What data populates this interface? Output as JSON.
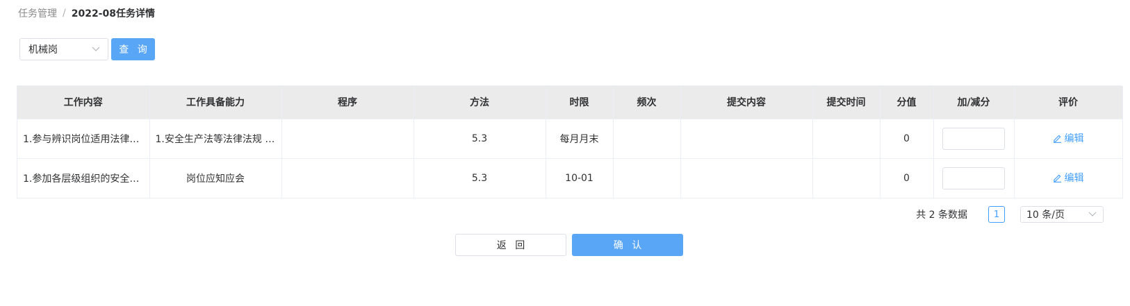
{
  "breadcrumb": {
    "parent": "任务管理",
    "separator": "/",
    "current": "2022-08任务详情"
  },
  "filter": {
    "selected_post": "机械岗",
    "query_label": "查 询"
  },
  "table": {
    "columns": [
      "工作内容",
      "工作具备能力",
      "程序",
      "方法",
      "时限",
      "频次",
      "提交内容",
      "提交时间",
      "分值",
      "加/减分",
      "评价"
    ],
    "rows": [
      {
        "content": "1.参与辨识岗位适用法律法...",
        "ability": "1.安全生产法等法律法规 2...",
        "procedure": "",
        "method": "5.3",
        "deadline": "每月月末",
        "frequency": "",
        "submission": "",
        "submit_time": "",
        "score": "0",
        "adjust": "",
        "evaluate_label": "编辑"
      },
      {
        "content": "1.参加各层级组织的安全生...",
        "ability": "岗位应知应会",
        "procedure": "",
        "method": "5.3",
        "deadline": "10-01",
        "frequency": "",
        "submission": "",
        "submit_time": "",
        "score": "0",
        "adjust": "",
        "evaluate_label": "编辑"
      }
    ]
  },
  "pagination": {
    "total_text": "共 2 条数据",
    "current_page": "1",
    "page_size": "10 条/页"
  },
  "actions": {
    "back_label": "返 回",
    "confirm_label": "确 认"
  },
  "colors": {
    "primary": "#409eff",
    "button_fill": "#58a6f5",
    "header_bg": "#ebebeb",
    "border": "#ebeef5"
  },
  "icons": {
    "select_arrow": "chevron-down-icon",
    "edit": "edit-icon"
  }
}
